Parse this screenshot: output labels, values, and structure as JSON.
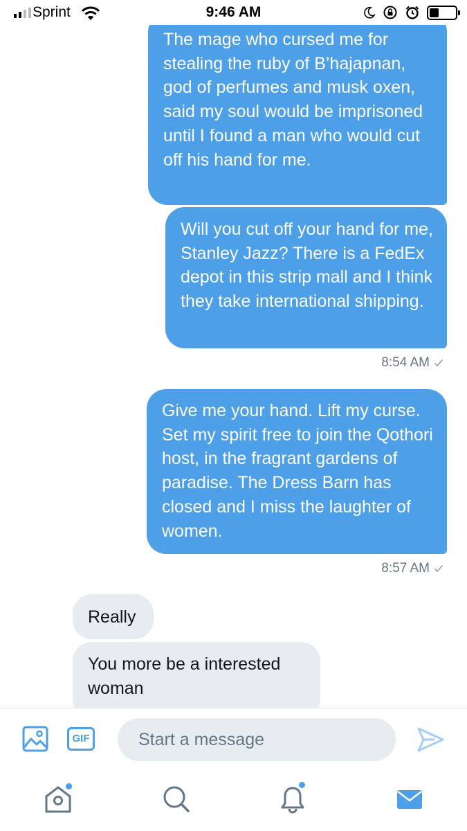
{
  "status_bar": {
    "carrier": "Sprint",
    "time": "9:46 AM",
    "battery_level": 0.35
  },
  "messages": [
    {
      "direction": "sent",
      "text": "The mage who cursed me for stealing the ruby of B’hajapnan, god of perfumes and musk oxen, said my soul would be imprisoned until I found a man who would cut off his hand for me."
    },
    {
      "direction": "sent",
      "text": "Will you cut off your hand for me, Stanley Jazz? There is a FedEx depot in this strip mall and I think they take international shipping."
    },
    {
      "direction": "sent",
      "text": "Give me your hand. Lift my curse. Set my spirit free to join the Qothori host, in the fragrant gardens of paradise. The Dress Barn has closed and I miss the laughter of women."
    },
    {
      "direction": "received",
      "text": "Really"
    },
    {
      "direction": "received",
      "text": "You more be a interested woman"
    }
  ],
  "timestamps": [
    "8:54 AM",
    "8:57 AM"
  ],
  "composer": {
    "gif_label": "GIF",
    "placeholder": "Start a message"
  },
  "tab_bar": {
    "items": [
      "home-icon",
      "search-icon",
      "notifications-icon",
      "messages-icon"
    ],
    "active": "messages-icon"
  },
  "colors": {
    "accent": "#4d9fe8",
    "received_bubble": "#e6ecf0",
    "muted_text": "#657786"
  }
}
